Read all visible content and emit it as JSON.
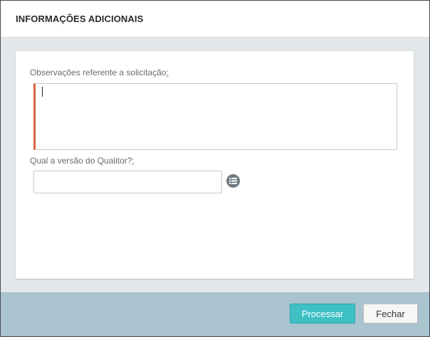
{
  "dialog": {
    "title": "INFORMAÇÕES ADICIONAIS"
  },
  "form": {
    "observacoes_label": "Observações referente a solicitação",
    "observacoes_value": "",
    "versao_label": "Qual a versão do Qualitor?",
    "versao_value": "",
    "colon": ":",
    "list_icon": "list-icon"
  },
  "footer": {
    "process_label": "Processar",
    "close_label": "Fechar"
  },
  "colors": {
    "required_accent": "#d9663f",
    "primary_button": "#3fc0c4",
    "footer_bg": "#a9c3cf"
  }
}
